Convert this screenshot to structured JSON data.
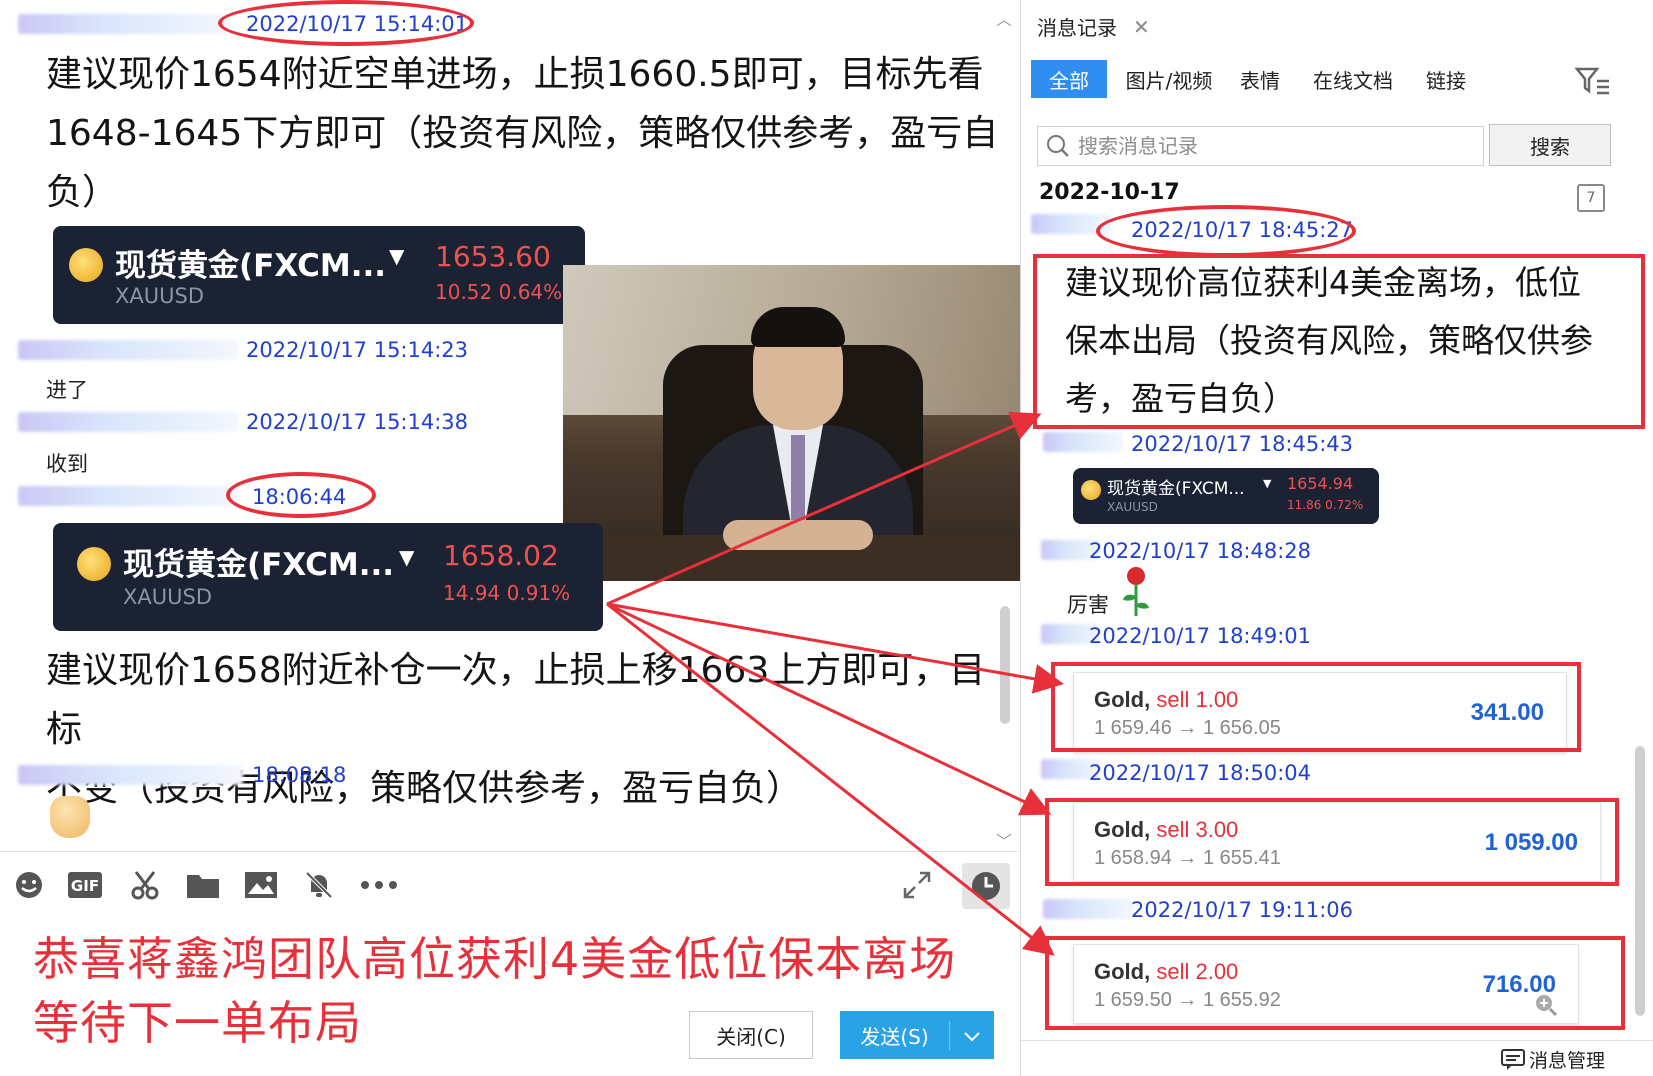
{
  "chat": {
    "messages": [
      {
        "time": "2022/10/17 15:14:01",
        "text_lines": [
          "建议现价1654附近空单进场，止损1660.5即可，目标先看",
          "1648-1645下方即可（投资有风险，策略仅供参考，盈亏自",
          "负）"
        ]
      },
      {
        "time": "2022/10/17 15:14:23",
        "text": "进了"
      },
      {
        "time": "2022/10/17 15:14:38",
        "text": "收到"
      },
      {
        "time": "18:06:44",
        "text_lines": [
          "建议现价1658附近补仓一次，止损上移1663上方即可，目标",
          "不变（投资有风险，策略仅供参考，盈亏自负）"
        ]
      },
      {
        "time": "18:08:18"
      }
    ],
    "quote_card_1": {
      "name": "现货黄金(FXCM...",
      "symbol": "XAUUSD",
      "price": "1653.60",
      "change": "10.52  0.64%"
    },
    "quote_card_2": {
      "name": "现货黄金(FXCM...",
      "symbol": "XAUUSD",
      "price": "1658.02",
      "change": "14.94  0.91%"
    }
  },
  "input": {
    "promo_line1": "恭喜蒋鑫鸿团队高位获利4美金低位保本离场",
    "promo_line2": "等待下一单布局",
    "close_label": "关闭(C)",
    "send_label": "发送(S)",
    "toolbar": [
      "smile-icon",
      "gif-icon",
      "scissors-icon",
      "folder-icon",
      "image-icon",
      "bell-off-icon",
      "more-icon"
    ]
  },
  "history": {
    "title": "消息记录",
    "tabs": [
      "全部",
      "图片/视频",
      "表情",
      "在线文档",
      "链接"
    ],
    "active_tab": "全部",
    "search_placeholder": "搜索消息记录",
    "search_button": "搜索",
    "date": "2022-10-17",
    "entries": [
      {
        "time": "2022/10/17 18:45:27",
        "text_lines": [
          "建议现价高位获利4美金离场，低位",
          "保本出局（投资有风险，策略仅供参",
          "考，盈亏自负）"
        ]
      },
      {
        "time": "2022/10/17 18:45:43"
      },
      {
        "time": "2022/10/17 18:48:28",
        "text": "厉害"
      },
      {
        "time": "2022/10/17 18:49:01"
      },
      {
        "time": "2022/10/17 18:50:04"
      },
      {
        "time": "2022/10/17 19:11:06"
      }
    ],
    "quote_card": {
      "name": "现货黄金(FXCM...",
      "symbol": "XAUUSD",
      "price": "1654.94",
      "change": "11.86  0.72%"
    },
    "trades": [
      {
        "label": "Gold,",
        "side": "sell 1.00",
        "route": "1 659.46 → 1 656.05",
        "amount": "341.00"
      },
      {
        "label": "Gold,",
        "side": "sell 3.00",
        "route": "1 658.94  →  1 655.41",
        "amount": "1 059.00"
      },
      {
        "label": "Gold,",
        "side": "sell 2.00",
        "route": "1 659.50 → 1 655.92",
        "amount": "716.00"
      }
    ],
    "manage_label": "消息管理"
  },
  "colors": {
    "accent_red": "#e8303a",
    "timestamp_blue": "#1f3fd0",
    "tab_blue": "#2f8ef0",
    "send_blue": "#2aa2e6"
  }
}
